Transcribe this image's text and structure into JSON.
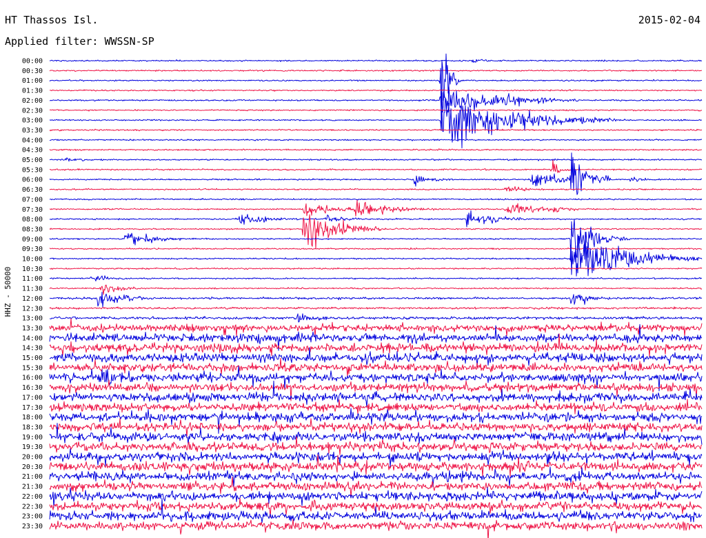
{
  "header": {
    "station": "HT Thassos Isl.",
    "date": "2015-02-04",
    "filter": "Applied filter: WWSSN-SP"
  },
  "chart_data": {
    "type": "line",
    "subtype": "helicorder",
    "ylabel": "HHZ - 50000",
    "colors": [
      "#0000dd",
      "#ee1144"
    ],
    "row_labels": [
      "00:00",
      "00:30",
      "01:00",
      "01:30",
      "02:00",
      "02:30",
      "03:00",
      "03:30",
      "04:00",
      "04:30",
      "05:00",
      "05:30",
      "06:00",
      "06:30",
      "07:00",
      "07:30",
      "08:00",
      "08:30",
      "09:00",
      "09:30",
      "10:00",
      "10:30",
      "11:00",
      "11:30",
      "12:00",
      "12:30",
      "13:00",
      "13:30",
      "14:00",
      "14:30",
      "15:00",
      "15:30",
      "16:00",
      "16:30",
      "17:00",
      "17:30",
      "18:00",
      "18:30",
      "19:00",
      "19:30",
      "20:00",
      "20:30",
      "21:00",
      "21:30",
      "22:00",
      "22:30",
      "23:00",
      "23:30"
    ],
    "rows_with_data": 48,
    "noise_level": [
      1,
      1,
      1,
      1,
      1,
      1,
      1,
      1,
      1,
      1,
      1,
      1,
      1,
      1,
      1,
      1,
      1,
      1,
      1,
      1,
      1,
      1,
      1,
      1,
      1.5,
      1.5,
      2,
      5,
      6,
      6,
      6,
      6,
      6,
      6,
      6,
      6,
      6,
      6,
      6,
      6,
      6,
      6,
      6,
      6,
      6,
      6,
      6,
      6
    ],
    "events": [
      {
        "row": 0,
        "x": 0.65,
        "amp": 3,
        "dur": 0.01
      },
      {
        "row": 2,
        "x": 0.6,
        "amp": 70,
        "dur": 0.01
      },
      {
        "row": 4,
        "x": 0.6,
        "amp": 25,
        "dur": 0.07
      },
      {
        "row": 4,
        "x": 0.69,
        "amp": 5,
        "dur": 0.02
      },
      {
        "row": 6,
        "x": 0.6,
        "amp": 45,
        "dur": 0.09
      },
      {
        "row": 10,
        "x": 0.025,
        "amp": 3,
        "dur": 0.02
      },
      {
        "row": 11,
        "x": 0.77,
        "amp": 14,
        "dur": 0.01
      },
      {
        "row": 12,
        "x": 0.56,
        "amp": 10,
        "dur": 0.02
      },
      {
        "row": 12,
        "x": 0.74,
        "amp": 16,
        "dur": 0.03
      },
      {
        "row": 12,
        "x": 0.8,
        "amp": 55,
        "dur": 0.02
      },
      {
        "row": 12,
        "x": 0.89,
        "amp": 5,
        "dur": 0.01
      },
      {
        "row": 13,
        "x": 0.7,
        "amp": 5,
        "dur": 0.02
      },
      {
        "row": 15,
        "x": 0.39,
        "amp": 14,
        "dur": 0.03
      },
      {
        "row": 15,
        "x": 0.47,
        "amp": 12,
        "dur": 0.04
      },
      {
        "row": 15,
        "x": 0.7,
        "amp": 10,
        "dur": 0.04
      },
      {
        "row": 15,
        "x": 0.775,
        "amp": 4,
        "dur": 0.01
      },
      {
        "row": 16,
        "x": 0.29,
        "amp": 10,
        "dur": 0.03
      },
      {
        "row": 16,
        "x": 0.425,
        "amp": 6,
        "dur": 0.02
      },
      {
        "row": 16,
        "x": 0.64,
        "amp": 16,
        "dur": 0.03
      },
      {
        "row": 17,
        "x": 0.39,
        "amp": 38,
        "dur": 0.04
      },
      {
        "row": 18,
        "x": 0.117,
        "amp": 14,
        "dur": 0.03
      },
      {
        "row": 18,
        "x": 0.8,
        "amp": 45,
        "dur": 0.03
      },
      {
        "row": 20,
        "x": 0.8,
        "amp": 45,
        "dur": 0.07
      },
      {
        "row": 22,
        "x": 0.06,
        "amp": 7,
        "dur": 0.02
      },
      {
        "row": 23,
        "x": 0.08,
        "amp": 10,
        "dur": 0.02
      },
      {
        "row": 24,
        "x": 0.075,
        "amp": 14,
        "dur": 0.03
      },
      {
        "row": 24,
        "x": 0.8,
        "amp": 14,
        "dur": 0.02
      },
      {
        "row": 26,
        "x": 0.38,
        "amp": 8,
        "dur": 0.02
      },
      {
        "row": 32,
        "x": 0.08,
        "amp": 10,
        "dur": 0.02
      }
    ]
  }
}
